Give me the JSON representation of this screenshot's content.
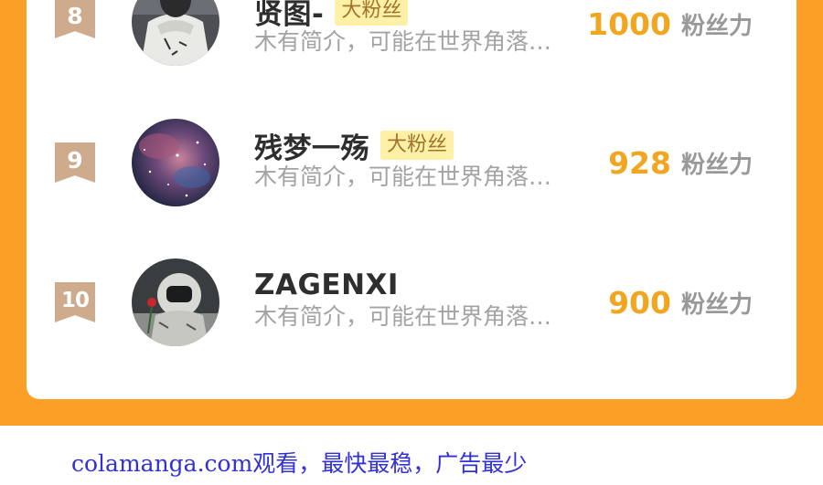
{
  "ranking": {
    "rows": [
      {
        "rank": "8",
        "name": "贤图-",
        "tag": "大粉丝",
        "bio": "木有简介，可能在世界角落…",
        "power_value": "1000",
        "power_unit": "粉丝力",
        "avatar_icon": "person-in-white-hoodie-avatar"
      },
      {
        "rank": "9",
        "name": "残梦一殇",
        "tag": "大粉丝",
        "bio": "木有简介，可能在世界角落…",
        "power_value": "928",
        "power_unit": "粉丝力",
        "avatar_icon": "galaxy-nebula-avatar"
      },
      {
        "rank": "10",
        "name": "ZAGENXI",
        "tag": "",
        "bio": "木有简介，可能在世界角落…",
        "power_value": "900",
        "power_unit": "粉丝力",
        "avatar_icon": "astronaut-with-rose-avatar"
      }
    ]
  },
  "footer": {
    "text": "colamanga.com观看，最快最稳，广告最少"
  },
  "colors": {
    "frame_orange": "#fb9f27",
    "rank_badge": "#cdab8c",
    "fan_tag_bg": "#fff0a8",
    "power_value": "#f2a51f",
    "footer_link": "#3131d6"
  }
}
